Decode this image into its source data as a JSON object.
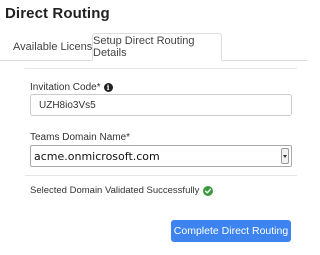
{
  "header": {
    "title": "Direct Routing"
  },
  "tabs": [
    {
      "label": "Available Licenses",
      "active": false
    },
    {
      "label": "Setup Direct Routing Details",
      "active": true
    }
  ],
  "form": {
    "invitation_code": {
      "label": "Invitation Code*",
      "value": "UZH8io3Vs5",
      "icon": "info-icon"
    },
    "teams_domain": {
      "label": "Teams Domain Name*",
      "value": "acme.onmicrosoft.com"
    },
    "status": {
      "text": "Selected Domain Validated Successfully",
      "icon": "check-circle-icon",
      "color": "#3c9a3c"
    },
    "submit_label": "Complete Direct Routing"
  },
  "colors": {
    "accent": "#3d84f0",
    "success": "#3c9a3c"
  }
}
